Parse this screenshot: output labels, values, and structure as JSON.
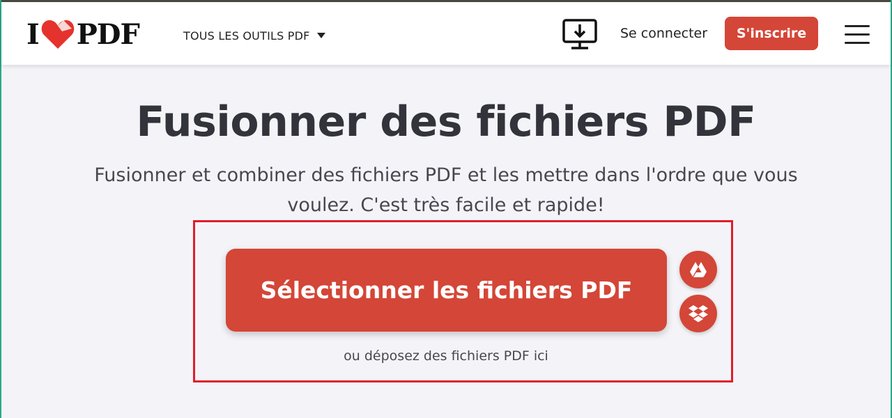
{
  "header": {
    "logo_left": "I",
    "logo_right": "PDF",
    "tools_menu_label": "TOUS LES OUTILS PDF",
    "login_label": "Se connecter",
    "signup_label": "S'inscrire"
  },
  "main": {
    "title": "Fusionner des fichiers PDF",
    "subtitle": "Fusionner et combiner des fichiers PDF et les mettre dans l'ordre que vous voulez. C'est très facile et rapide!",
    "select_button_label": "Sélectionner les fichiers PDF",
    "drop_hint": "ou déposez des fichiers PDF ici"
  },
  "icons": {
    "desktop": "desktop-download-icon",
    "drive": "google-drive-icon",
    "dropbox": "dropbox-icon",
    "menu": "hamburger-menu-icon",
    "dropdown": "caret-down-icon"
  },
  "colors": {
    "brand_red": "#d44637",
    "highlight_border": "#e11d2c",
    "background": "#f4f4f8"
  }
}
